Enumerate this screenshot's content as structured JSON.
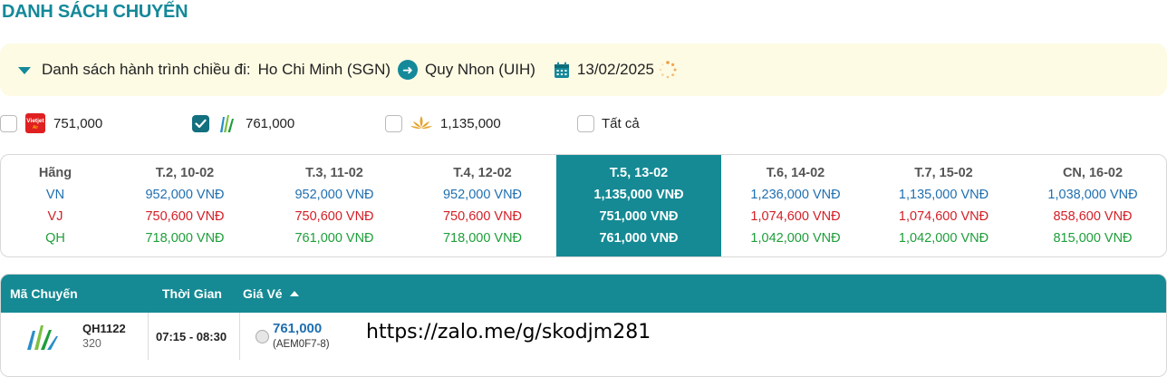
{
  "title": "DANH SÁCH CHUYẾN",
  "route": {
    "label": "Danh sách hành trình chiều đi:",
    "from": "Ho Chi Minh (SGN)",
    "to": "Quy Nhon (UIH)",
    "date": "13/02/2025",
    "icons": [
      "caret-down-icon",
      "arrow-right-icon",
      "calendar-icon",
      "loading-spinner-icon"
    ]
  },
  "filters": [
    {
      "airline": "Vietjet Air",
      "price": "751,000",
      "checked": false,
      "icon": "vietjet-logo-icon"
    },
    {
      "airline": "Bamboo Airways",
      "price": "761,000",
      "checked": true,
      "icon": "bamboo-logo-icon"
    },
    {
      "airline": "Vietnam Airlines",
      "price": "1,135,000",
      "checked": false,
      "icon": "vietnam-airlines-logo-icon"
    },
    {
      "airline": "all",
      "price": "Tất cả",
      "checked": false
    }
  ],
  "price_calendar": {
    "header": "Hãng",
    "airlines": [
      "VN",
      "VJ",
      "QH"
    ],
    "days": [
      {
        "label": "T.2, 10-02",
        "vn": "952,000 VNĐ",
        "vj": "750,600 VNĐ",
        "qh": "718,000 VNĐ"
      },
      {
        "label": "T.3, 11-02",
        "vn": "952,000 VNĐ",
        "vj": "750,600 VNĐ",
        "qh": "761,000 VNĐ"
      },
      {
        "label": "T.4, 12-02",
        "vn": "952,000 VNĐ",
        "vj": "750,600 VNĐ",
        "qh": "718,000 VNĐ"
      },
      {
        "label": "T.5, 13-02",
        "vn": "1,135,000 VNĐ",
        "vj": "751,000 VNĐ",
        "qh": "761,000 VNĐ",
        "selected": true
      },
      {
        "label": "T.6, 14-02",
        "vn": "1,236,000 VNĐ",
        "vj": "1,074,600 VNĐ",
        "qh": "1,042,000 VNĐ"
      },
      {
        "label": "T.7, 15-02",
        "vn": "1,135,000 VNĐ",
        "vj": "1,074,600 VNĐ",
        "qh": "1,042,000 VNĐ"
      },
      {
        "label": "CN, 16-02",
        "vn": "1,038,000 VNĐ",
        "vj": "858,600 VNĐ",
        "qh": "815,000 VNĐ"
      }
    ],
    "colors": {
      "vn": "#1f6fb0",
      "vj": "#d31f26",
      "qh": "#1e9e3a",
      "selected_bg": "#158a94"
    }
  },
  "flights": {
    "columns": {
      "code": "Mã Chuyến",
      "time": "Thời Gian",
      "price": "Giá Vé"
    },
    "rows": [
      {
        "code": "QH1122",
        "aircraft": "320",
        "time": "07:15 - 08:30",
        "price": "761,000",
        "fare_class": "(AEM0F7-8)",
        "logo": "bamboo-logo-icon"
      }
    ],
    "overlay_text": "https://zalo.me/g/skodjm281"
  }
}
